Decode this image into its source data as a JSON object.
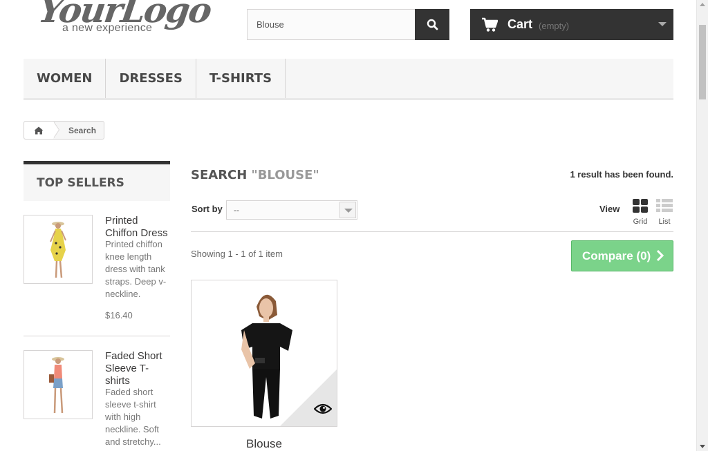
{
  "header": {
    "logo_main": "YourLogo",
    "logo_sub": "a new experience",
    "search_value": "Blouse",
    "search_icon": "search-icon",
    "cart_label": "Cart",
    "cart_qty": "(empty)",
    "cart_icon": "shopping-cart-icon"
  },
  "menu": {
    "items": [
      {
        "label": "WOMEN"
      },
      {
        "label": "DRESSES"
      },
      {
        "label": "T-SHIRTS"
      }
    ]
  },
  "breadcrumb": {
    "home_icon": "home-icon",
    "current": "Search"
  },
  "top_sellers": {
    "title": "TOP SELLERS",
    "items": [
      {
        "name": "Printed Chiffon Dress",
        "description": "Printed chiffon knee length dress with tank straps. Deep v-neckline.",
        "price": "$16.40"
      },
      {
        "name": "Faded Short Sleeve T-shirts",
        "description": "Faded short sleeve t-shirt with high neckline. Soft and stretchy...",
        "price": ""
      }
    ]
  },
  "main": {
    "title": "SEARCH",
    "query": "\"BLOUSE\"",
    "result_count": "1 result has been found.",
    "sort_label": "Sort by",
    "sort_value": "--",
    "view_label": "View",
    "view_grid": "Grid",
    "view_list": "List",
    "showing": "Showing 1 - 1 of 1 item",
    "compare": "Compare (0)",
    "products": [
      {
        "name": "Blouse"
      }
    ]
  },
  "colors": {
    "dark": "#333333",
    "compare_green": "#7bd38a",
    "menu_bg": "#f6f6f6"
  }
}
